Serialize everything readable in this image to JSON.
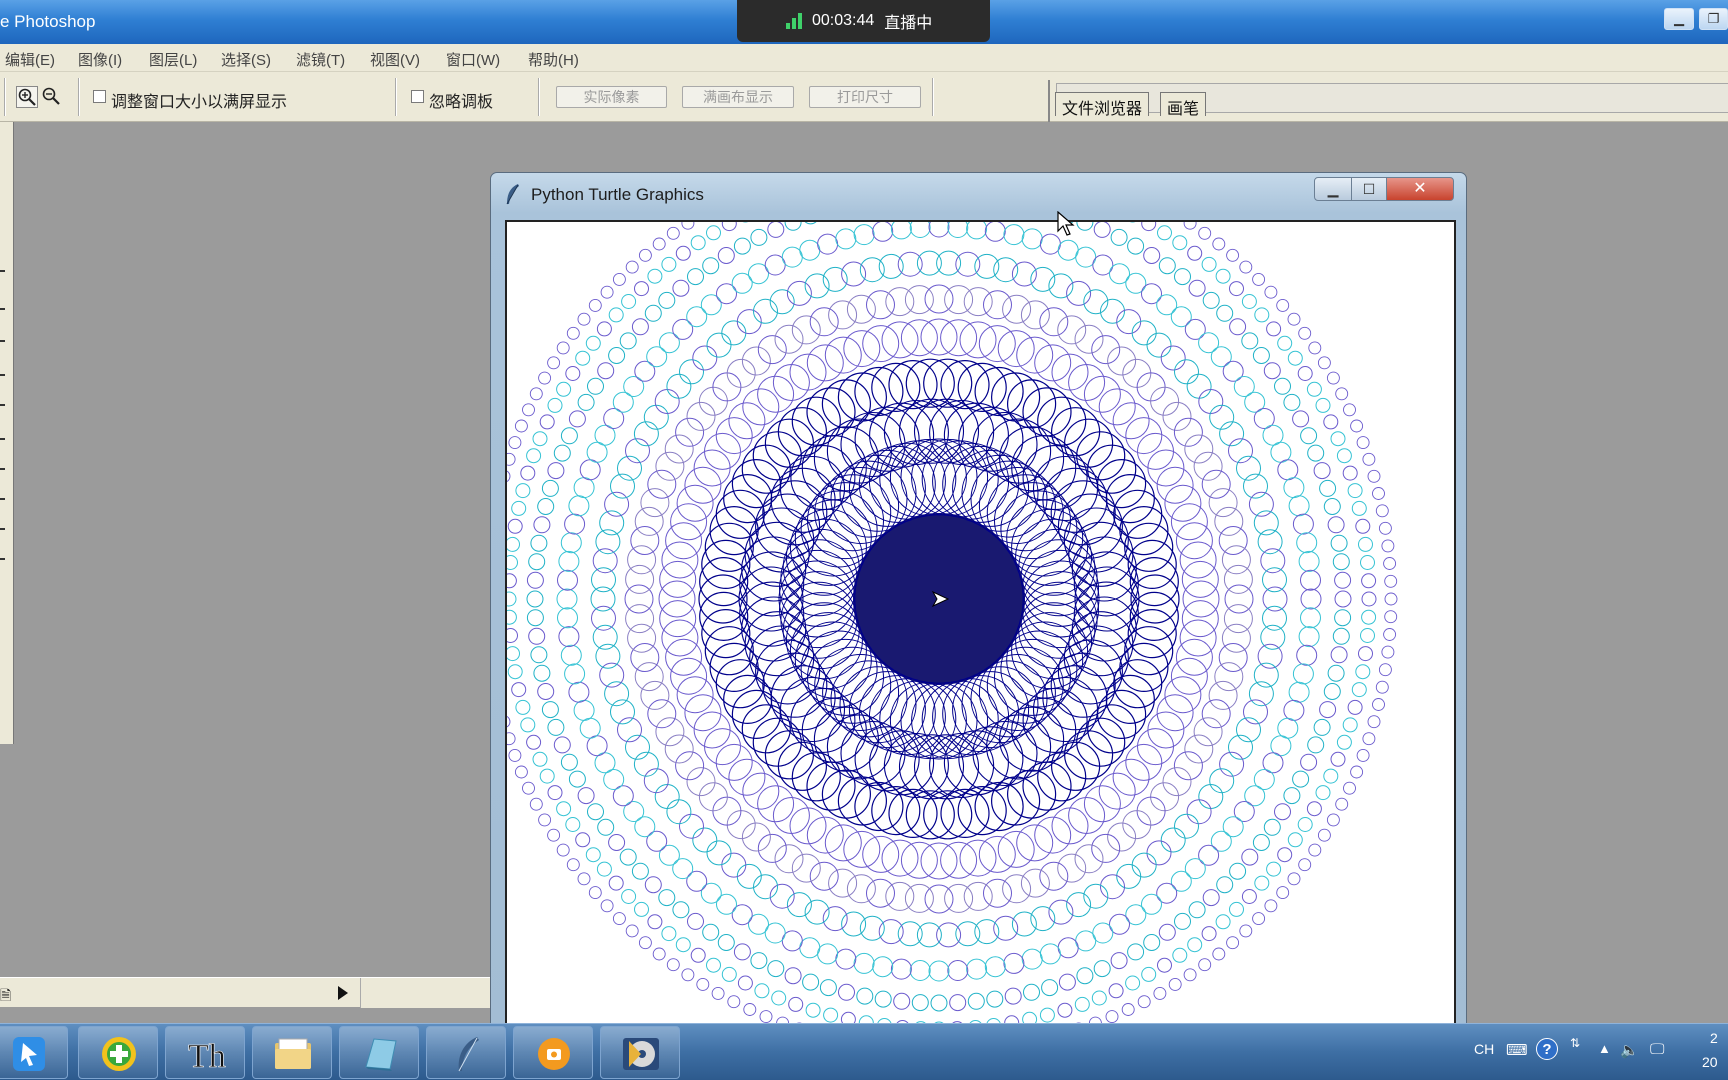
{
  "photoshop": {
    "title": "e Photoshop",
    "menu": [
      "编辑(E)",
      "图像(I)",
      "图层(L)",
      "选择(S)",
      "滤镜(T)",
      "视图(V)",
      "窗口(W)",
      "帮助(H)"
    ],
    "options": {
      "resize_window_label": "调整窗口大小以满屏显示",
      "ignore_palettes_label": "忽略调板",
      "actual_pixels_button": "实际像素",
      "fit_on_screen_button": "满画布显示",
      "print_size_button": "打印尺寸"
    },
    "palette_tabs": [
      "文件浏览器",
      "画笔"
    ]
  },
  "live_overlay": {
    "elapsed": "00:03:44",
    "status": "直播中",
    "signal_color": "#3fd16a"
  },
  "turtle_window": {
    "title": "Python Turtle Graphics",
    "close_color": "#c8432e",
    "canvas": {
      "pattern": "concentric rings of small circles",
      "colors": [
        "#191970",
        "#00008b",
        "#6a5acd",
        "#8a7fc4",
        "#20b2c7",
        "#36c3d4"
      ]
    }
  },
  "taskbar": {
    "apps": [
      "pointer-app-icon",
      "add-app-icon",
      "th-app-icon",
      "folder-icon",
      "notebook-icon",
      "feather-icon",
      "orange-app-icon",
      "disc-app-icon"
    ],
    "tray": {
      "language": "CH",
      "clock_top": "2",
      "clock_bottom": "20"
    }
  }
}
